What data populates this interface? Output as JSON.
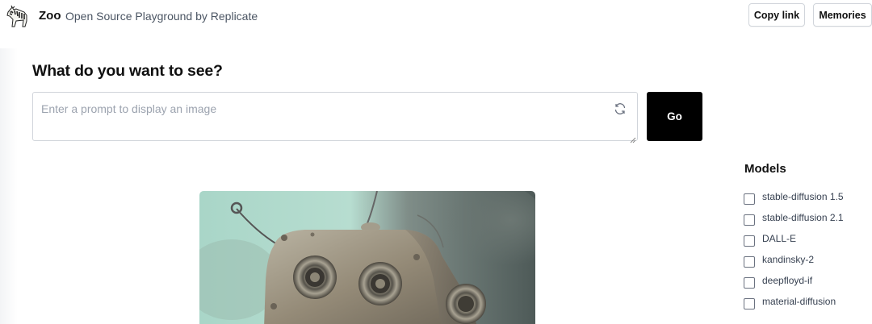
{
  "header": {
    "logo_icon": "zebra-icon",
    "brand": "Zoo",
    "subtitle": "Open Source Playground by Replicate",
    "copy_link_label": "Copy link",
    "memories_label": "Memories"
  },
  "main": {
    "heading": "What do you want to see?",
    "prompt": {
      "placeholder": "Enter a prompt to display an image",
      "value": "",
      "icon": "refresh-icon"
    },
    "go_label": "Go",
    "image_icon": "robot-image"
  },
  "models": {
    "title": "Models",
    "items": [
      {
        "label": "stable-diffusion 1.5",
        "checked": false
      },
      {
        "label": "stable-diffusion 2.1",
        "checked": false
      },
      {
        "label": "DALL-E",
        "checked": false
      },
      {
        "label": "kandinsky-2",
        "checked": false
      },
      {
        "label": "deepfloyd-if",
        "checked": false
      },
      {
        "label": "material-diffusion",
        "checked": false
      }
    ]
  },
  "colors": {
    "go_button": "#000000",
    "border": "#d1d5db",
    "placeholder": "#9ca3af"
  }
}
